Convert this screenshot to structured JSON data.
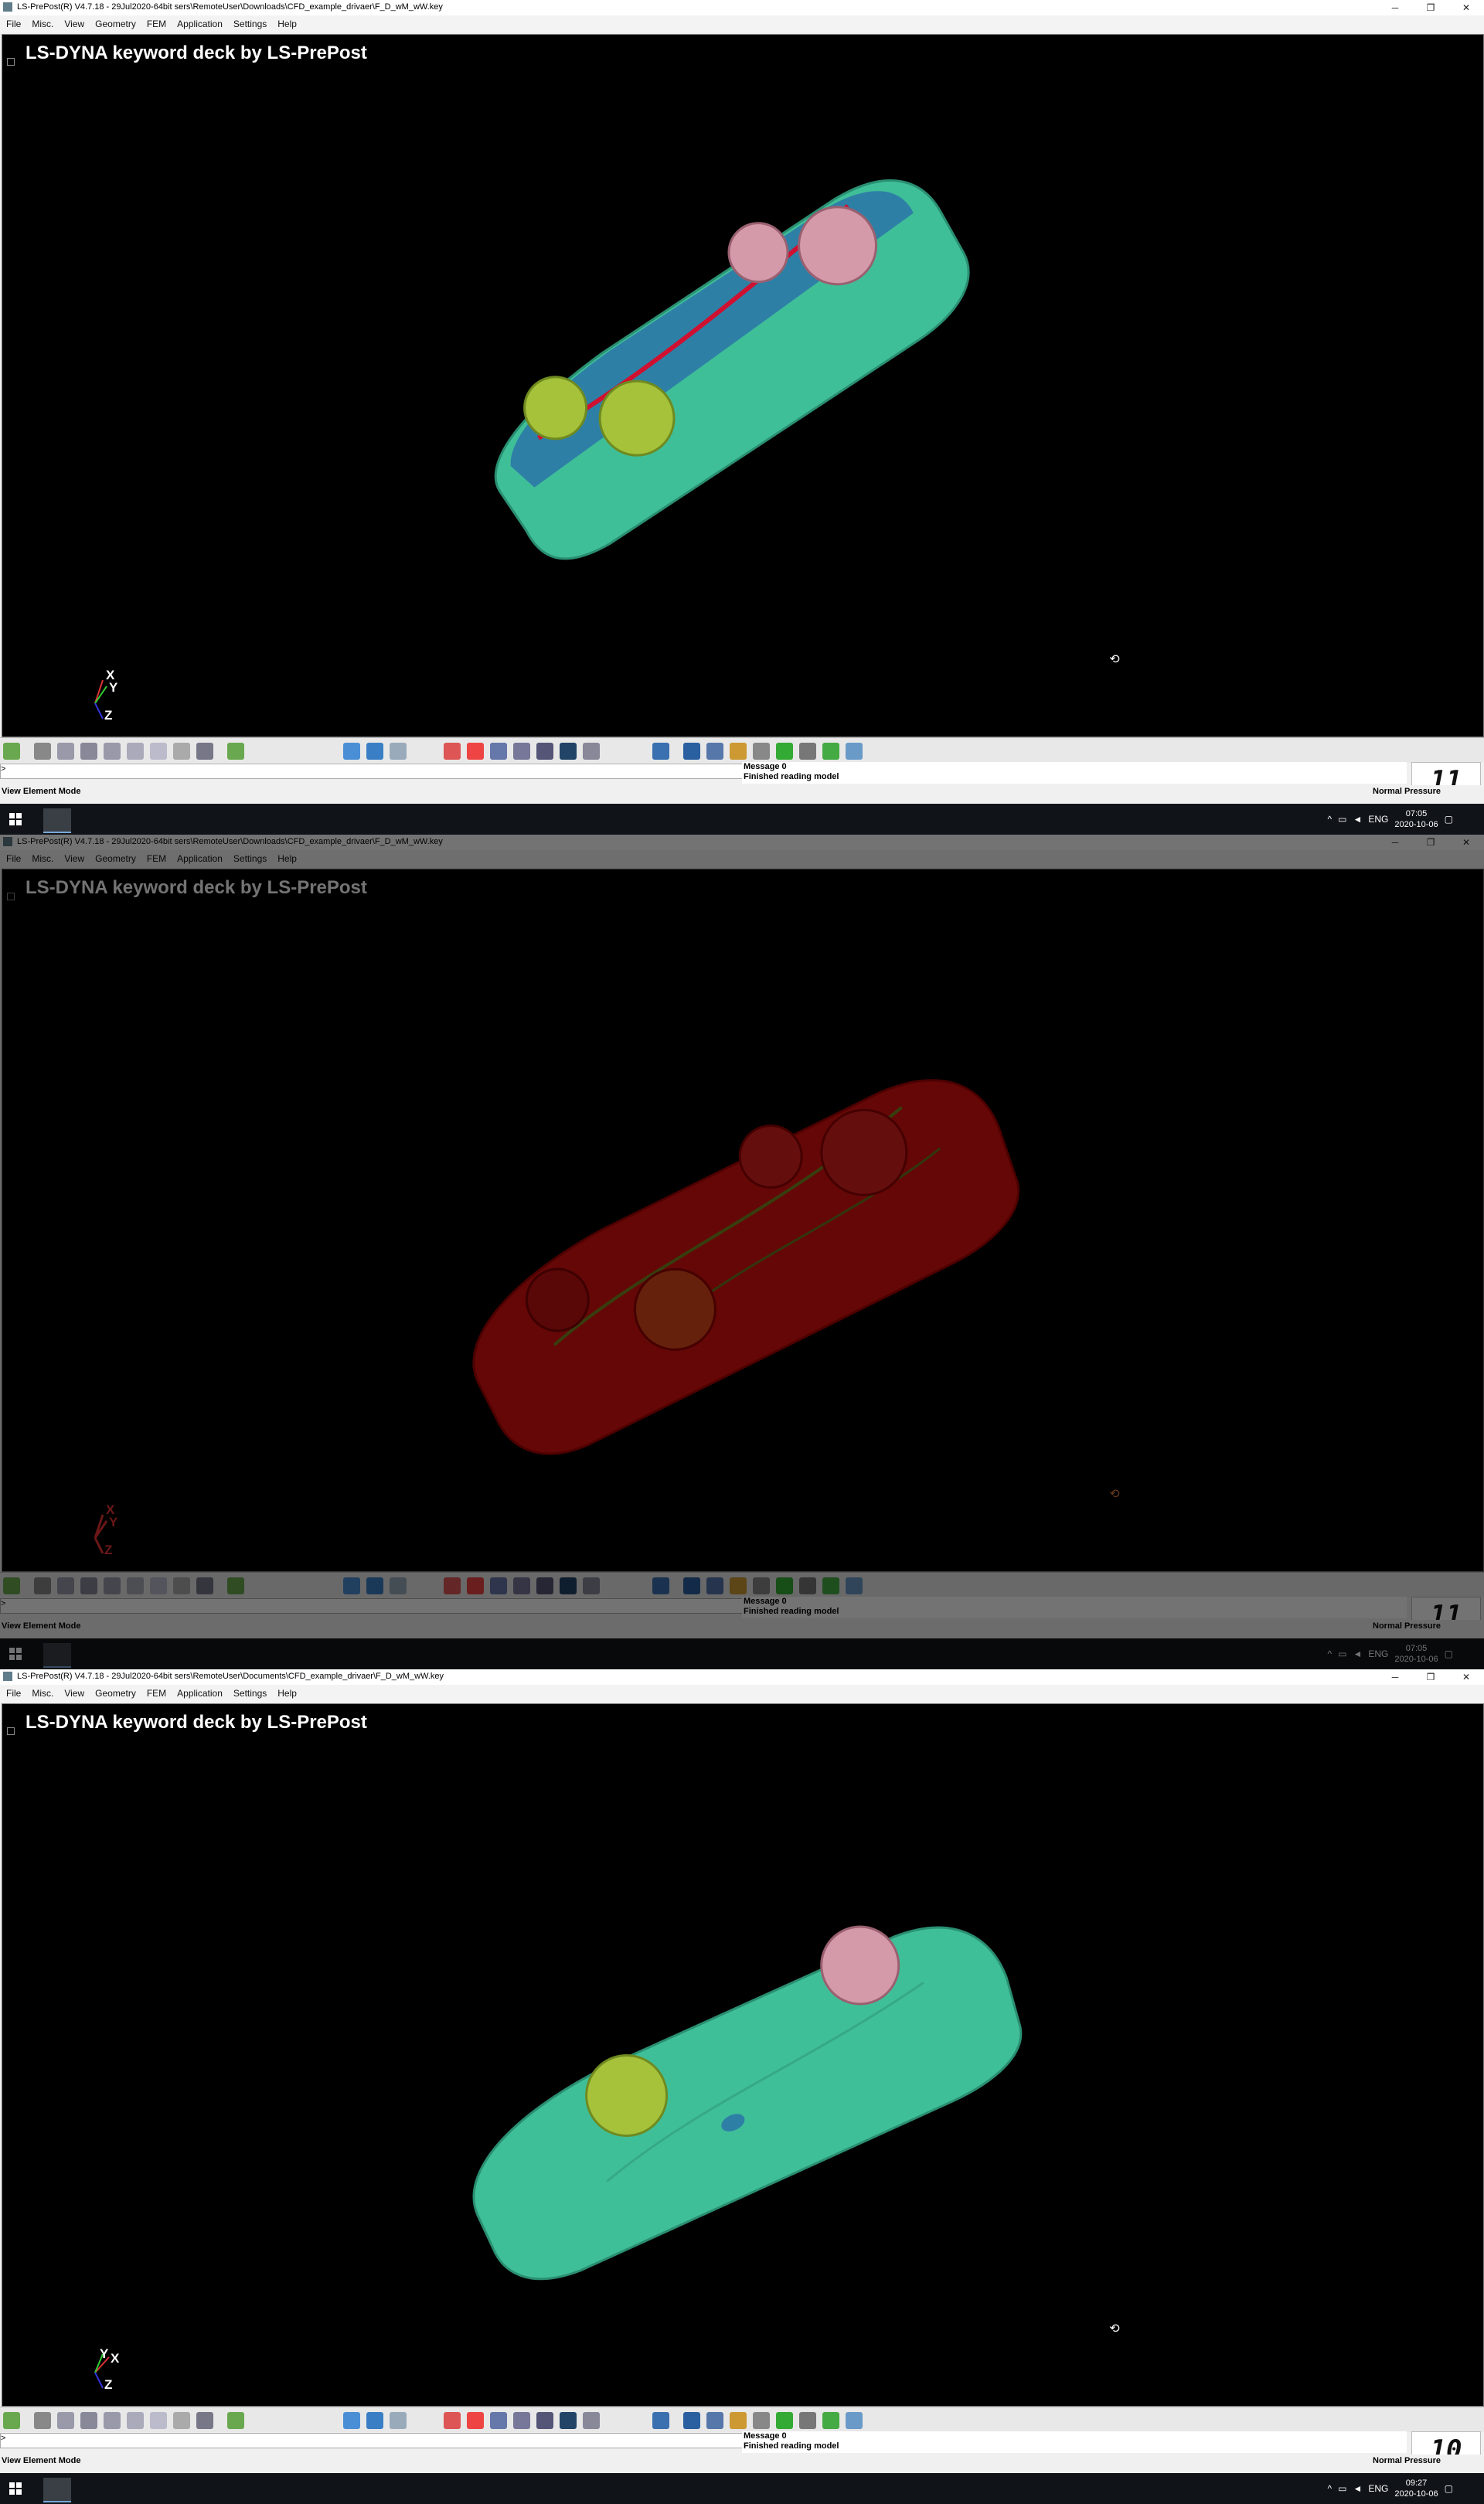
{
  "window": {
    "min_icon": "─",
    "max_icon": "❐",
    "close_icon": "✕"
  },
  "menu": [
    "File",
    "Misc.",
    "View",
    "Geometry",
    "FEM",
    "Application",
    "Settings",
    "Help"
  ],
  "viewport": {
    "deck_title": "LS-DYNA keyword deck by LS-PrePost"
  },
  "triad": {
    "x": "X",
    "y": "Y",
    "z": "Z"
  },
  "command": {
    "prompt": ">"
  },
  "status": {
    "mode": "View Element Mode",
    "message_1": "Message 0",
    "message_2": "Finished reading model",
    "right": "Normal Pressure"
  },
  "taskbar": {
    "lang": "ENG"
  },
  "panels": [
    {
      "title": "LS-PrePost(R) V4.7.18 - 29Jul2020-64bit sers\\RemoteUser\\Downloads\\CFD_example_drivaer\\F_D_wM_wW.key",
      "counter": "11",
      "time": "07:05",
      "date": "2020-10-06",
      "car_style": "teal-blue underside with red edges",
      "colors": {
        "body": "#3fbf98",
        "underside": "#2e7fa6",
        "front_wheel": "#a6c23a",
        "rear_wheel": "#d49aaa"
      }
    },
    {
      "title": "LS-PrePost(R) V4.7.18 - 29Jul2020-64bit sers\\RemoteUser\\Downloads\\CFD_example_drivaer\\F_D_wM_wW.key",
      "counter": "11",
      "time": "07:05",
      "date": "2020-10-06",
      "car_style": "red highlighted selection",
      "colors": {
        "body": "#e01010",
        "underside": "#c51010",
        "front_wheel": "#e04a1a",
        "rear_wheel": "#e02020"
      }
    },
    {
      "title": "LS-PrePost(R) V4.7.18 - 29Jul2020-64bit sers\\RemoteUser\\Documents\\CFD_example_drivaer\\F_D_wM_wW.key",
      "counter": "10",
      "time": "09:27",
      "date": "2020-10-06",
      "car_style": "teal body top view",
      "colors": {
        "body": "#3fbf98",
        "underside": "#36a888",
        "front_wheel": "#a6c23a",
        "rear_wheel": "#d49aaa"
      }
    }
  ]
}
